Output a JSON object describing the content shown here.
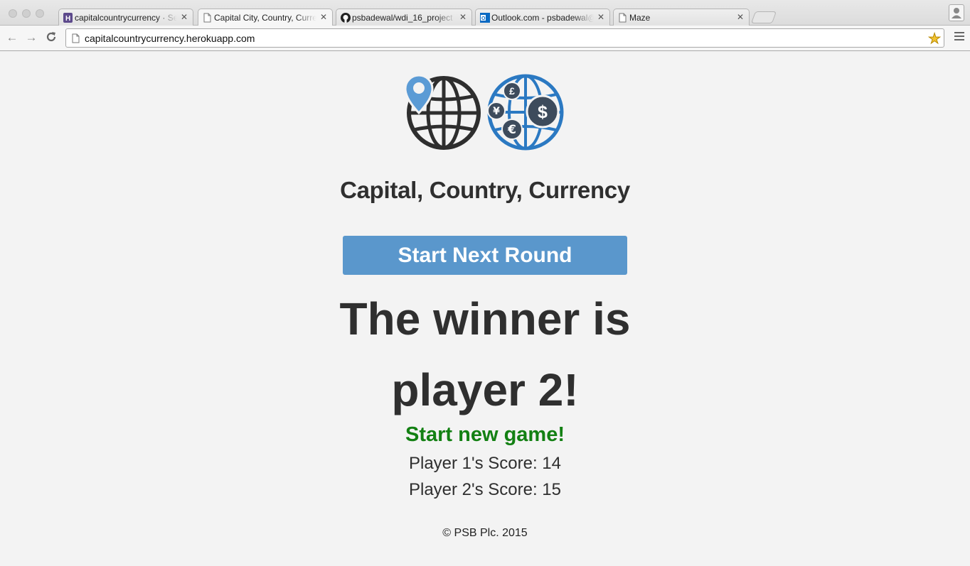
{
  "browser": {
    "tabs": [
      {
        "title": "capitalcountrycurrency · Se",
        "favicon": "heroku-icon",
        "active": false
      },
      {
        "title": "Capital City, Country, Curre",
        "favicon": "page-icon",
        "active": true
      },
      {
        "title": "psbadewal/wdi_16_project",
        "favicon": "github-icon",
        "active": false
      },
      {
        "title": "Outlook.com - psbadewal@",
        "favicon": "outlook-icon",
        "active": false
      },
      {
        "title": "Maze",
        "favicon": "page-icon",
        "active": false
      }
    ],
    "url": "capitalcountrycurrency.herokuapp.com",
    "accent_star": "#f1c232"
  },
  "page": {
    "logo_icons": [
      "map-pin-globe-icon",
      "currency-globe-icon"
    ],
    "title": "Capital, Country, Currency",
    "next_round_label": "Start Next Round",
    "winner_line": "The winner is player 2!",
    "new_game_label": "Start new game!",
    "player1_score": "Player 1's Score: 14",
    "player2_score": "Player 2's Score: 15",
    "footer": "© PSB Plc. 2015",
    "colors": {
      "button": "#5a97cc",
      "new_game": "#138013",
      "text": "#2f2f2f",
      "pin": "#5b9bd5",
      "currency_globe": "#2b79c2"
    }
  }
}
